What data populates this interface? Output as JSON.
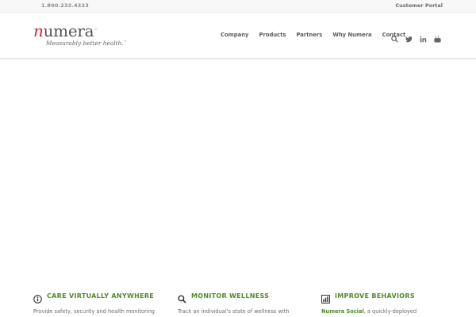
{
  "topbar": {
    "phone": "1.800.233.4323",
    "portal_label": "Customer Portal"
  },
  "logo": {
    "first_letter": "n",
    "rest": "umera",
    "tm": "™",
    "tagline": "Measurably better health.",
    "tagline_tm": "™"
  },
  "nav": {
    "items": [
      "Company",
      "Products",
      "Partners",
      "Why Numera",
      "Contact"
    ],
    "icons": [
      "search-icon",
      "twitter-icon",
      "linkedin-icon",
      "youtube-icon"
    ]
  },
  "features": [
    {
      "title": "CARE VIRTUALLY ANYWHERE",
      "icon": "info-icon",
      "text": "Provide safety, security and health monitoring"
    },
    {
      "title": "MONITOR WELLNESS",
      "icon": "search-icon",
      "text": "Track an individual's state of wellness with"
    },
    {
      "title": "IMPROVE BEHAVIORS",
      "icon": "chart-icon",
      "text_link": "Numera Social",
      "text_rest": ", a quickly-deployed"
    }
  ],
  "colors": {
    "accent_green": "#4e8a2a",
    "logo_red": "#c8272d"
  }
}
